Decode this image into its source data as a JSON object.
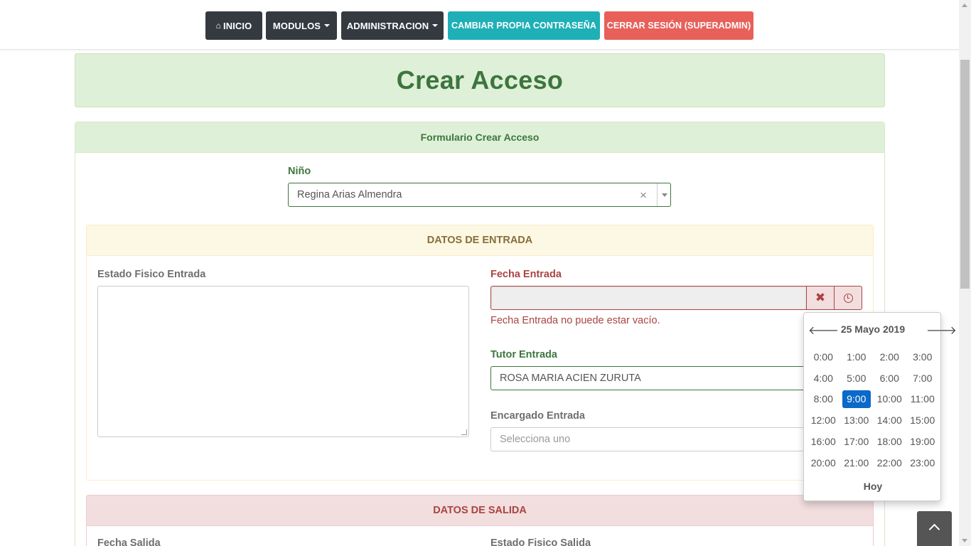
{
  "nav": {
    "inicio": "INICIO",
    "modulos": "MODULOS",
    "administracion": "ADMINISTRACION",
    "cambiar": "CAMBIAR PROPIA CONTRASEÑA",
    "cerrar": "CERRAR SESIÓN (SUPERADMIN)",
    "home_icon": "home-icon"
  },
  "page": {
    "title": "Crear Acceso"
  },
  "form": {
    "header": "Formulario Crear Acceso",
    "nino_label": "Niño",
    "nino_value": "Regina Arias Almendra",
    "clear_glyph": "×"
  },
  "entrada": {
    "header": "DATOS DE ENTRADA",
    "estado_label": "Estado Fisico Entrada",
    "fecha_label": "Fecha Entrada",
    "fecha_value": "",
    "fecha_error": "Fecha Entrada no puede estar vacío.",
    "clear_glyph": "✖",
    "tutor_label": "Tutor Entrada",
    "tutor_value": "ROSA MARIA ACIEN ZURUTA",
    "encargado_label": "Encargado Entrada",
    "encargado_placeholder": "Selecciona uno"
  },
  "salida": {
    "header": "DATOS DE SALIDA",
    "fecha_label": "Fecha Salida",
    "estado_label": "Estado Fisico Salida"
  },
  "picker": {
    "title": "25 Mayo 2019",
    "prev": "🡐",
    "next": "🡒",
    "hours": [
      "0:00",
      "1:00",
      "2:00",
      "3:00",
      "4:00",
      "5:00",
      "6:00",
      "7:00",
      "8:00",
      "9:00",
      "10:00",
      "11:00",
      "12:00",
      "13:00",
      "14:00",
      "15:00",
      "16:00",
      "17:00",
      "18:00",
      "19:00",
      "20:00",
      "21:00",
      "22:00",
      "23:00"
    ],
    "selected": "9:00",
    "today": "Hoy"
  },
  "colors": {
    "success": "#3c763d",
    "danger": "#a94442",
    "warning": "#8a6d3b",
    "selected_hour": "#0a69c9"
  }
}
